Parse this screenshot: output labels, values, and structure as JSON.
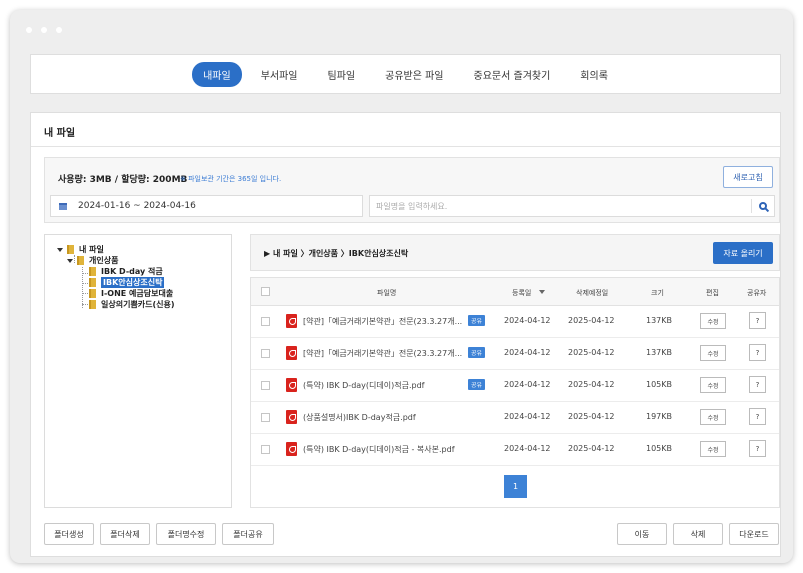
{
  "nav": {
    "tabs": [
      {
        "label": "내파일",
        "active": true
      },
      {
        "label": "부서파일",
        "active": false
      },
      {
        "label": "팀파일",
        "active": false
      },
      {
        "label": "공유받은 파일",
        "active": false
      },
      {
        "label": "중요문서 즐겨찾기",
        "active": false
      },
      {
        "label": "회의록",
        "active": false
      }
    ]
  },
  "panel": {
    "title": "내 파일"
  },
  "usage": {
    "text": "사용량: 3MB / 할당량: 200MB",
    "note": "※ 파일보관 기간은 365일 입니다.",
    "refresh_label": "새로고침",
    "date_range": "2024-01-16 ~ 2024-04-16",
    "search_placeholder": "파일명을 입력하세요."
  },
  "tree": {
    "root": "내 파일",
    "child": "개인상품",
    "items": [
      "IBK D-day 적금",
      "IBK안심상조신탁",
      "I-ONE 예금담보대출",
      "일상의기쁨카드(신용)"
    ],
    "selected_index": 1
  },
  "breadcrumb": "▶ 내 파일 〉개인상품 〉IBK안심상조신탁",
  "upload_label": "자료 올리기",
  "table": {
    "headers": {
      "filename": "파일명",
      "reg_date": "등록일",
      "del_date": "삭제예정일",
      "size": "크기",
      "edit": "편집",
      "sharer": "공유자"
    },
    "rows": [
      {
        "name": "[약관]「예금거래기본약관」전문(23.3.27개...",
        "shared": "공유",
        "reg": "2024-04-12",
        "del": "2025-04-12",
        "size": "137KB",
        "edit": "수정",
        "q": "?"
      },
      {
        "name": "[약관]「예금거래기본약관」전문(23.3.27개...",
        "shared": "공유",
        "reg": "2024-04-12",
        "del": "2025-04-12",
        "size": "137KB",
        "edit": "수정",
        "q": "?"
      },
      {
        "name": "(특약) IBK D-day(디데이)적금.pdf",
        "shared": "공유",
        "reg": "2024-04-12",
        "del": "2025-04-12",
        "size": "105KB",
        "edit": "수정",
        "q": "?"
      },
      {
        "name": "(상품설명서)IBK D-day적금.pdf",
        "shared": "",
        "reg": "2024-04-12",
        "del": "2025-04-12",
        "size": "197KB",
        "edit": "수정",
        "q": "?"
      },
      {
        "name": "(특약) IBK D-day(디데이)적금 - 복사본.pdf",
        "shared": "",
        "reg": "2024-04-12",
        "del": "2025-04-12",
        "size": "105KB",
        "edit": "수정",
        "q": "?"
      }
    ],
    "page": "1"
  },
  "bottom": {
    "folder_create": "폴더생성",
    "folder_delete": "폴더삭제",
    "folder_rename": "폴더명수정",
    "folder_share": "폴더공유",
    "move": "이동",
    "delete": "삭제",
    "download": "다운로드"
  }
}
